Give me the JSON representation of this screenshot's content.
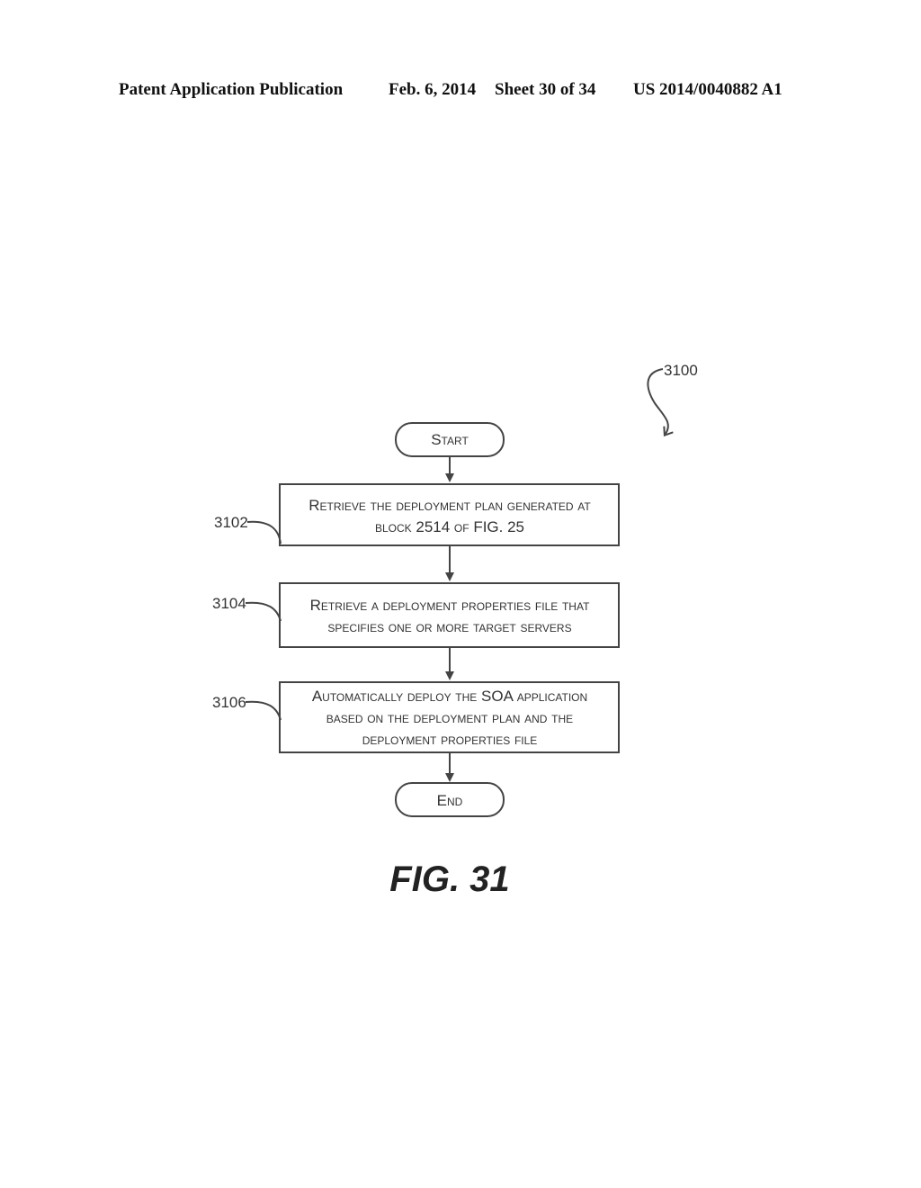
{
  "header": {
    "publication": "Patent Application Publication",
    "date": "Feb. 6, 2014",
    "sheet": "Sheet 30 of 34",
    "number": "US 2014/0040882 A1"
  },
  "diagram": {
    "ref": "3100",
    "start": "Start",
    "end": "End",
    "steps": [
      {
        "ref": "3102",
        "lines": [
          "Retrieve the deployment plan generated at",
          "block 2514 of FIG. 25"
        ]
      },
      {
        "ref": "3104",
        "lines": [
          "Retrieve a deployment properties file that",
          "specifies one or more target servers"
        ]
      },
      {
        "ref": "3106",
        "lines": [
          "Automatically deploy the SOA application",
          "based on the deployment plan and the",
          "deployment properties file"
        ]
      }
    ],
    "caption": "FIG. 31"
  }
}
